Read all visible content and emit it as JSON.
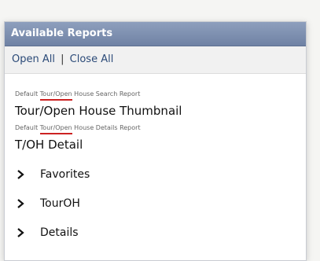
{
  "panel": {
    "title": "Available Reports",
    "open_all": "Open All",
    "separator": "|",
    "close_all": "Close All"
  },
  "reports": [
    {
      "caption_prefix": "Default",
      "caption_highlight": "Tour/Open",
      "caption_suffix": "House Search Report",
      "name": "Tour/Open House Thumbnail"
    },
    {
      "caption_prefix": "Default",
      "caption_highlight": "Tour/Open",
      "caption_suffix": "House Details Report",
      "name": "T/OH Detail"
    }
  ],
  "groups": [
    {
      "icon": "chevron-right-icon",
      "label": "Favorites"
    },
    {
      "icon": "chevron-right-icon",
      "label": "TourOH"
    },
    {
      "icon": "chevron-right-icon",
      "label": "Details"
    }
  ],
  "colors": {
    "header_bg": "#7a8cae",
    "link": "#2b4a78",
    "underline": "#cc2222"
  }
}
